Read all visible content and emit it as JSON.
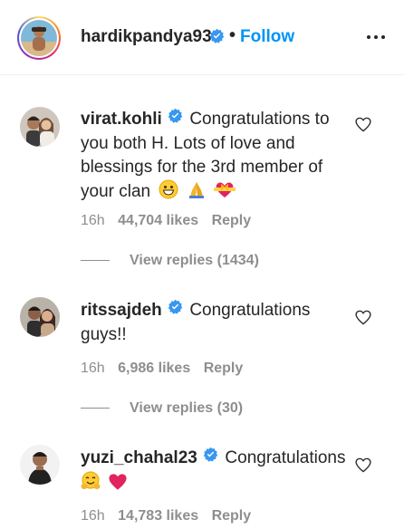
{
  "post_owner": {
    "username": "hardikpandya93",
    "separator": "•",
    "follow_label": "Follow"
  },
  "comments": [
    {
      "username": "virat.kohli",
      "text": "Congratulations to you both H. Lots of love and blessings for the 3rd member of your clan",
      "emojis": [
        "grinning-face",
        "folded-hands",
        "heart-with-ribbon"
      ],
      "time": "16h",
      "likes": "44,704 likes",
      "reply_label": "Reply",
      "view_replies": "View replies (1434)"
    },
    {
      "username": "ritssajdeh",
      "text": "Congratulations guys!!",
      "time": "16h",
      "likes": "6,986 likes",
      "reply_label": "Reply",
      "view_replies": "View replies (30)"
    },
    {
      "username": "yuzi_chahal23",
      "text": "Congratulations",
      "emojis": [
        "hugging-face",
        "red-heart"
      ],
      "time": "16h",
      "likes": "14,783 likes",
      "reply_label": "Reply"
    }
  ],
  "colors": {
    "text": "#262626",
    "secondary": "#8e8e8e",
    "link_blue": "#0095f6",
    "verified_blue": "#3897f0",
    "border": "#efefef"
  }
}
